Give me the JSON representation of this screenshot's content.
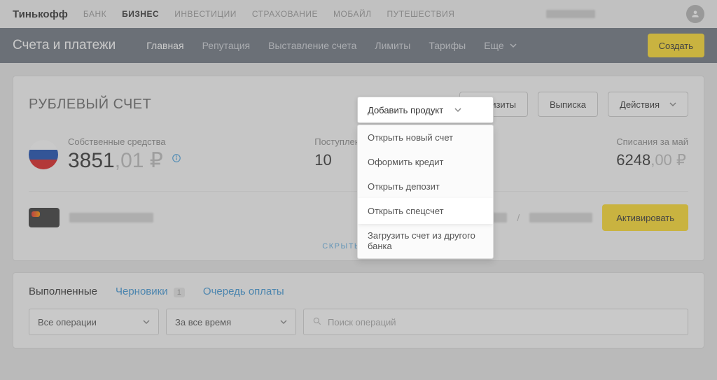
{
  "topnav": {
    "logo": "Тинькофф",
    "items": [
      "БАНК",
      "БИЗНЕС",
      "ИНВЕСТИЦИИ",
      "СТРАХОВАНИЕ",
      "МОБАЙЛ",
      "ПУТЕШЕСТВИЯ"
    ],
    "active_index": 1
  },
  "subnav": {
    "title": "Счета и платежи",
    "items": [
      "Главная",
      "Репутация",
      "Выставление счета",
      "Лимиты",
      "Тарифы",
      "Еще"
    ],
    "active_index": 0,
    "create": "Создать"
  },
  "account": {
    "title": "РУБЛЕВЫЙ СЧЕТ",
    "add_product": "Добавить продукт",
    "buttons": {
      "requisites": "Реквизиты",
      "statement": "Выписка",
      "actions": "Действия"
    },
    "own_label": "Собственные средства",
    "own_int": "3851",
    "own_dec": ",01 ₽",
    "in_label": "Поступления за май",
    "in_value": "10",
    "out_label": "Списания за май",
    "out_int": "6248",
    "out_dec": ",00 ₽",
    "activate": "Активировать",
    "hide_cards": "СКРЫТЬ КАРТЫ"
  },
  "dropdown": {
    "trigger": "Добавить продукт",
    "items": [
      "Открыть новый счет",
      "Оформить кредит",
      "Открыть депозит",
      "Открыть спецсчет",
      "Загрузить счет из другого банка"
    ],
    "highlight_index": 3
  },
  "ops": {
    "tabs": {
      "done": "Выполненные",
      "drafts": "Черновики",
      "queue": "Очередь оплаты",
      "drafts_count": "1"
    },
    "filter_type": "Все операции",
    "filter_time": "За все время",
    "search_placeholder": "Поиск операций"
  }
}
